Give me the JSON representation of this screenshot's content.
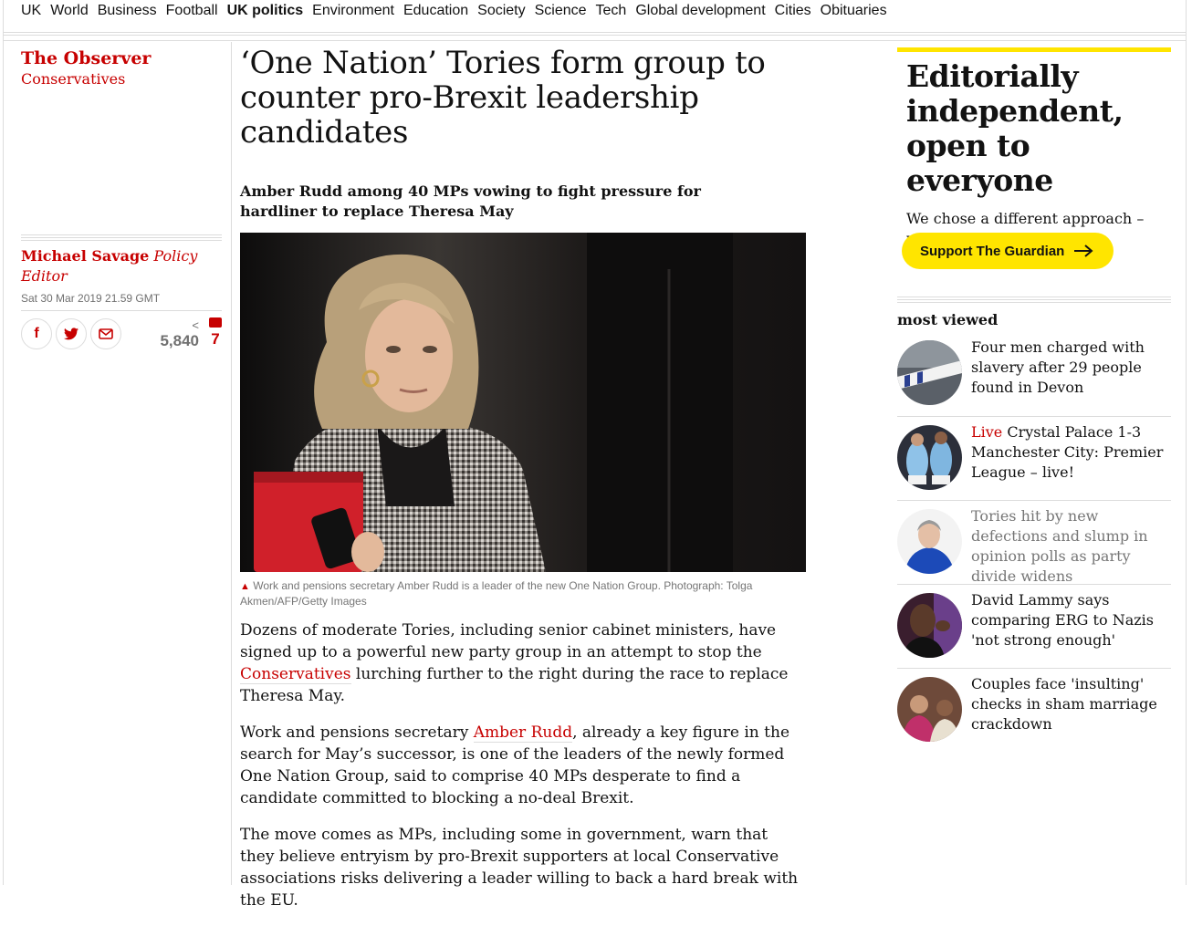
{
  "subnav": [
    "UK",
    "World",
    "Business",
    "Football",
    "UK politics",
    "Environment",
    "Education",
    "Society",
    "Science",
    "Tech",
    "Global development",
    "Cities",
    "Obituaries"
  ],
  "series": {
    "publication": "The Observer",
    "section": "Conservatives"
  },
  "byline": {
    "name": "Michael Savage",
    "role": "Policy Editor",
    "date": "Sat 30 Mar 2019 21.59 GMT"
  },
  "share": {
    "facebook": "f",
    "count": "5,840",
    "comments": "7"
  },
  "article": {
    "headline": "‘One Nation’ Tories form group to counter pro-Brexit leadership candidates",
    "standfirst": "Amber Rudd among 40 MPs vowing to fight pressure for hardliner to replace Theresa May",
    "caption": "Work and pensions secretary Amber Rudd is a leader of the new One Nation Group. Photograph: Tolga Akmen/AFP/Getty Images",
    "p1_a": "Dozens of moderate Tories, including senior cabinet ministers, have signed up to a powerful new party group in an attempt to stop the ",
    "p1_link": "Conservatives",
    "p1_b": " lurching further to the right during the race to replace Theresa May.",
    "p2_a": "Work and pensions secretary ",
    "p2_link": "Amber Rudd",
    "p2_b": ", already a key figure in the search for May’s successor, is one of the leaders of the newly formed One Nation Group, said to comprise 40 MPs desperate to find a candidate committed to blocking a no-deal Brexit.",
    "p3": "The move comes as MPs, including some in government, warn that they believe entryism by pro-Brexit supporters at local Conservative associations risks delivering a leader willing to back a hard break with the EU."
  },
  "support": {
    "title": "Editorially independent, open to everyone",
    "text": "We chose a different approach – will you support it?",
    "button": "Support The Guardian"
  },
  "most_viewed": {
    "title": "most viewed",
    "items": [
      {
        "kicker": "",
        "title": "Four men charged with slavery after 29 people found in Devon"
      },
      {
        "kicker": "Live",
        "title": " Crystal Palace 1-3 Manchester City: Premier League – live!"
      },
      {
        "kicker": "",
        "title": "Tories hit by new defections and slump in opinion polls as party divide widens"
      },
      {
        "kicker": "",
        "title": "David Lammy says comparing ERG to Nazis 'not strong enough'"
      },
      {
        "kicker": "",
        "title": "Couples face 'insulting' checks in sham marriage crackdown"
      }
    ]
  },
  "colors": {
    "accent": "#c70000",
    "support_yellow": "#ffe500",
    "rule": "#dcdcdc"
  }
}
